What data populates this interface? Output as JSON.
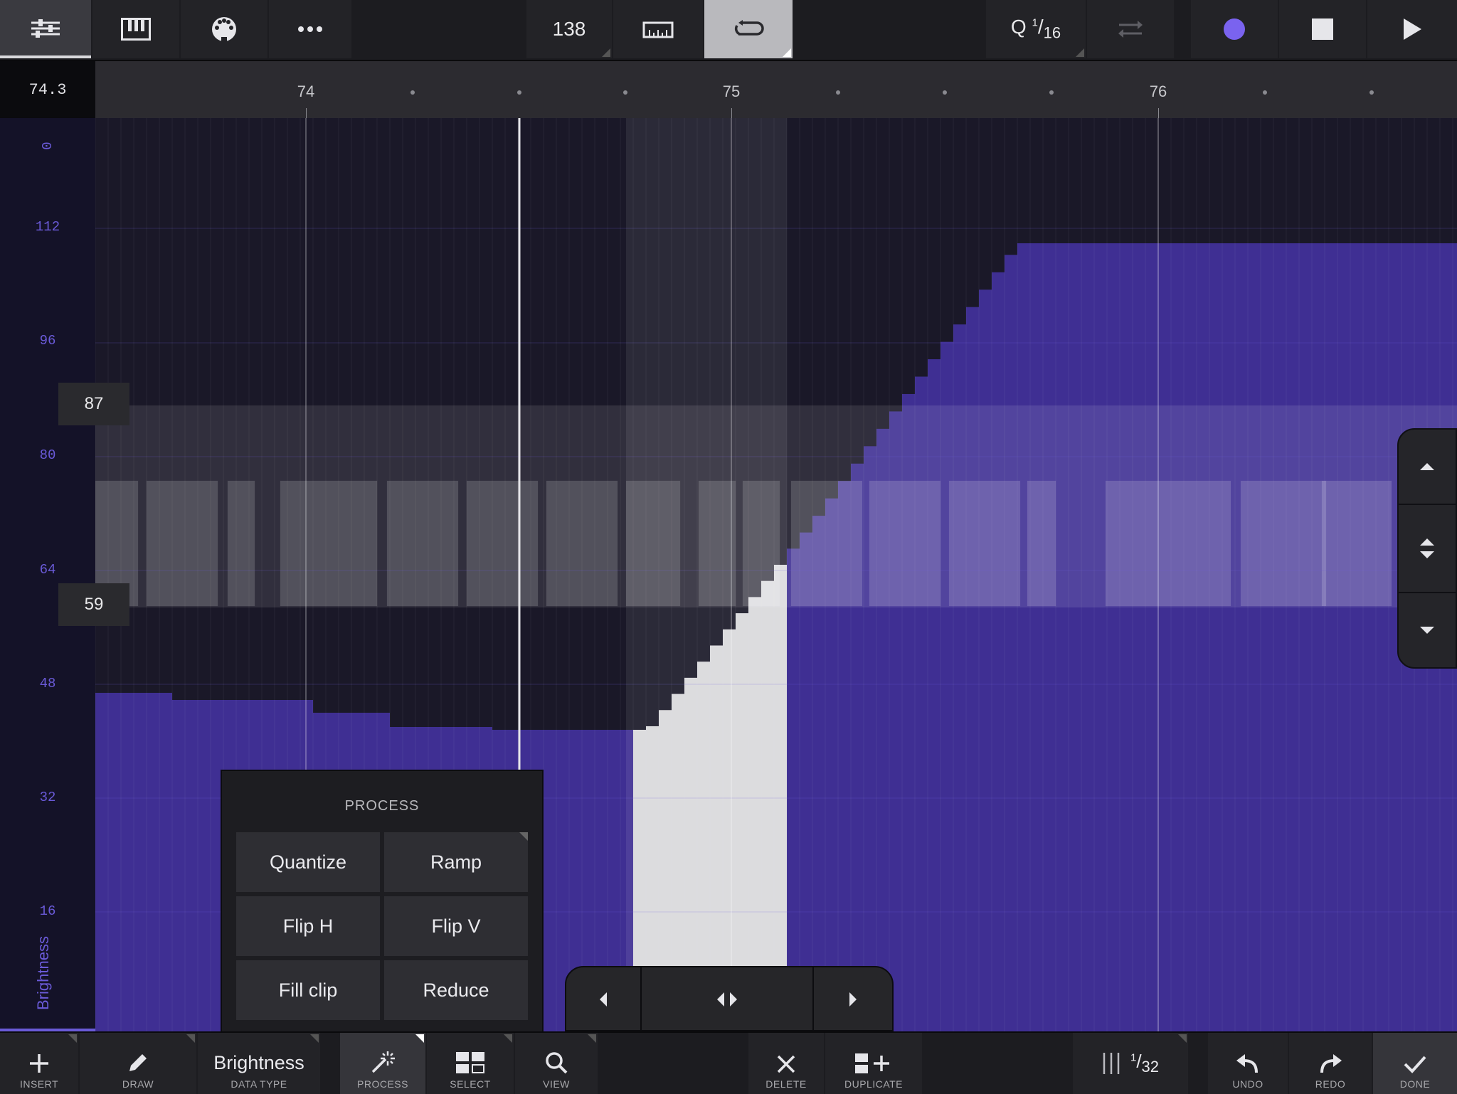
{
  "top_toolbar": {
    "tempo": "138",
    "quantize_prefix": "Q",
    "quantize_num": "1",
    "quantize_den": "16",
    "icons": [
      "mixer-icon",
      "piano-keys-icon",
      "midi-port-icon",
      "more-icon",
      "metronome-ruler-icon",
      "loop-icon",
      "quantize-arrows-icon",
      "record-icon",
      "stop-icon",
      "play-icon"
    ]
  },
  "ruler": {
    "position": "74.3",
    "bars": [
      {
        "label": "74",
        "beat": 74
      },
      {
        "label": "75",
        "beat": 75
      },
      {
        "label": "76",
        "beat": 76
      }
    ]
  },
  "axis": {
    "name": "Brightness",
    "labels": [
      "0",
      "112",
      "96",
      "80",
      "64",
      "48",
      "32",
      "16"
    ],
    "range_high": "87",
    "range_low": "59"
  },
  "colors": {
    "accent": "#3f2f93",
    "accent_light": "#6a5ad8",
    "selection": "#d9d9dc",
    "record": "#7a63ef"
  },
  "process_panel": {
    "title": "PROCESS",
    "buttons": [
      "Quantize",
      "Ramp",
      "Flip H",
      "Flip V",
      "Fill clip",
      "Reduce"
    ]
  },
  "bottom_toolbar": {
    "insert": "INSERT",
    "draw": "DRAW",
    "data_type_value": "Brightness",
    "data_type": "DATA TYPE",
    "process": "PROCESS",
    "select": "SELECT",
    "view": "VIEW",
    "delete": "DELETE",
    "duplicate": "DUPLICATE",
    "grid_num": "1",
    "grid_den": "32",
    "undo": "UNDO",
    "redo": "REDO",
    "done": "DONE"
  }
}
